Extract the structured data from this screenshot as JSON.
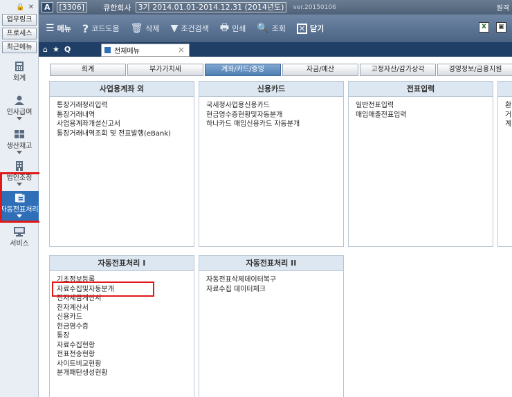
{
  "rail": {
    "top_icons": [
      "🔒",
      "✕"
    ],
    "tabs": [
      "업무링크",
      "프로세스",
      "최근메뉴"
    ],
    "items": [
      {
        "label": "회계",
        "icon": "calculator-icon"
      },
      {
        "label": "인사급여",
        "icon": "person-icon"
      },
      {
        "label": "생산재고",
        "icon": "box-icon"
      },
      {
        "label": "법인조정",
        "icon": "building-icon"
      },
      {
        "label": "자동전표처리",
        "icon": "auto-slip-icon"
      },
      {
        "label": "서비스",
        "icon": "monitor-icon"
      }
    ]
  },
  "titlebar": {
    "code": "[3306]",
    "company": "큐한회사",
    "period": "3기  2014.01.01-2014.12.31  (2014년도)",
    "version": "ver.20150106",
    "right": "원격"
  },
  "toolbar": {
    "menu": "메뉴",
    "code_help": "코드도움",
    "delete": "삭제",
    "filter": "조건검색",
    "print": "인쇄",
    "inquiry": "조회",
    "close": "닫기"
  },
  "tabs": {
    "main_label": "전체메뉴",
    "close_symbol": "×"
  },
  "categories": [
    "회계",
    "부가가치세",
    "계좌/카드/증빙",
    "자금/예산",
    "고정자산/감가상각",
    "경영정보/금융지원"
  ],
  "active_category": "계좌/카드/증빙",
  "panels": [
    {
      "title": "사업용계좌 외",
      "items": [
        "통장거래정리입력",
        "통장거래내역",
        "사업용계좌개설신고서",
        "통장거래내역조회 및 전표발행(eBank)"
      ]
    },
    {
      "title": "신용카드",
      "items": [
        "국세청사업용신용카드",
        "현금영수증현황및자동분개",
        "하나카드 매입신용카드 자동분개"
      ]
    },
    {
      "title": "전표입력",
      "items": [
        "일반전표입력",
        "매입매출전표입력"
      ]
    },
    {
      "title": "",
      "items": [
        "환",
        "거",
        "계"
      ]
    },
    {
      "title": "자동전표처리 I",
      "items": [
        "기초정보등록",
        "자료수집및자동분개",
        "전자세금계산서",
        "전자계산서",
        "신용카드",
        "현금영수증",
        "통장",
        "자료수집현황",
        "전표전송현황",
        "사이트비교현황",
        "분개패턴생성현황"
      ]
    },
    {
      "title": "자동전표처리 II",
      "items": [
        "자동전표삭제데이터복구",
        "자료수집 데이터체크"
      ]
    }
  ],
  "colors": {
    "accent": "#2f6fb8",
    "highlight": "#e01818",
    "toolbar": "#5a7292"
  }
}
